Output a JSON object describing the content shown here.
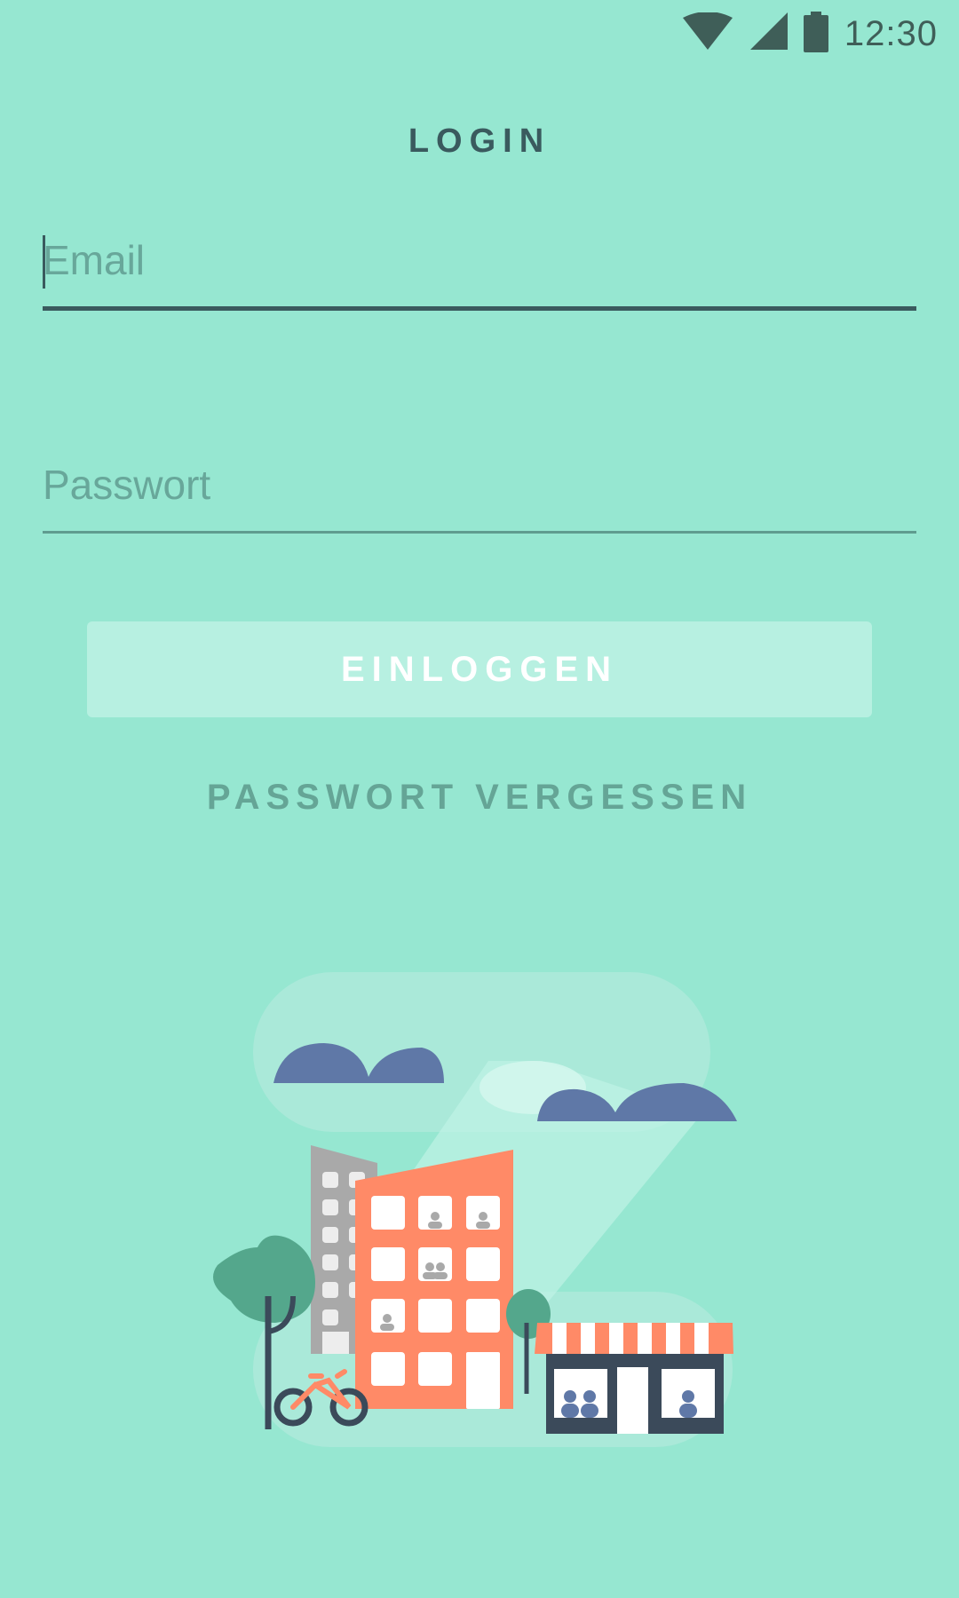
{
  "status_bar": {
    "time": "12:30",
    "icons": [
      "wifi-icon",
      "signal-icon",
      "battery-icon"
    ]
  },
  "screen": {
    "title": "LOGIN"
  },
  "form": {
    "email": {
      "placeholder": "Email",
      "value": ""
    },
    "password": {
      "placeholder": "Passwort",
      "value": ""
    },
    "login_button_label": "EINLOGGEN",
    "forgot_password_label": "PASSWORT VERGESSEN"
  },
  "colors": {
    "background": "#96e7d1",
    "primary_text": "#3a5a5e",
    "button_bg": "#b7f0e1",
    "accent_orange": "#ff8a67",
    "cloud_blue": "#5f78a7"
  },
  "illustration": {
    "name": "city-illustration"
  }
}
